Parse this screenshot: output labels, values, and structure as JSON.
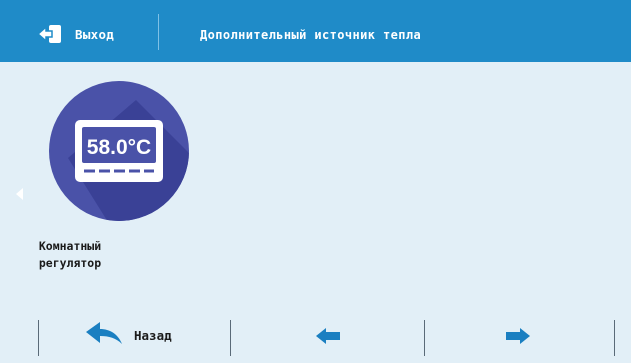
{
  "header": {
    "exit_label": "Выход",
    "title": "Дополнительный источник тепла"
  },
  "tile": {
    "display_value": "58.0°C",
    "label_line1": "Комнатный",
    "label_line2": "регулятор"
  },
  "nav": {
    "back_label": "Назад"
  },
  "colors": {
    "header_bg": "#1f8bc8",
    "page_bg": "#e2eff7",
    "tile_circle": "#4a52a8",
    "arrow_blue": "#1a7fc1"
  },
  "icons": {
    "exit": "exit-door-icon",
    "back": "back-arrow-icon",
    "prev": "arrow-left-icon",
    "next": "arrow-right-icon",
    "scroll": "scroll-left-icon"
  }
}
